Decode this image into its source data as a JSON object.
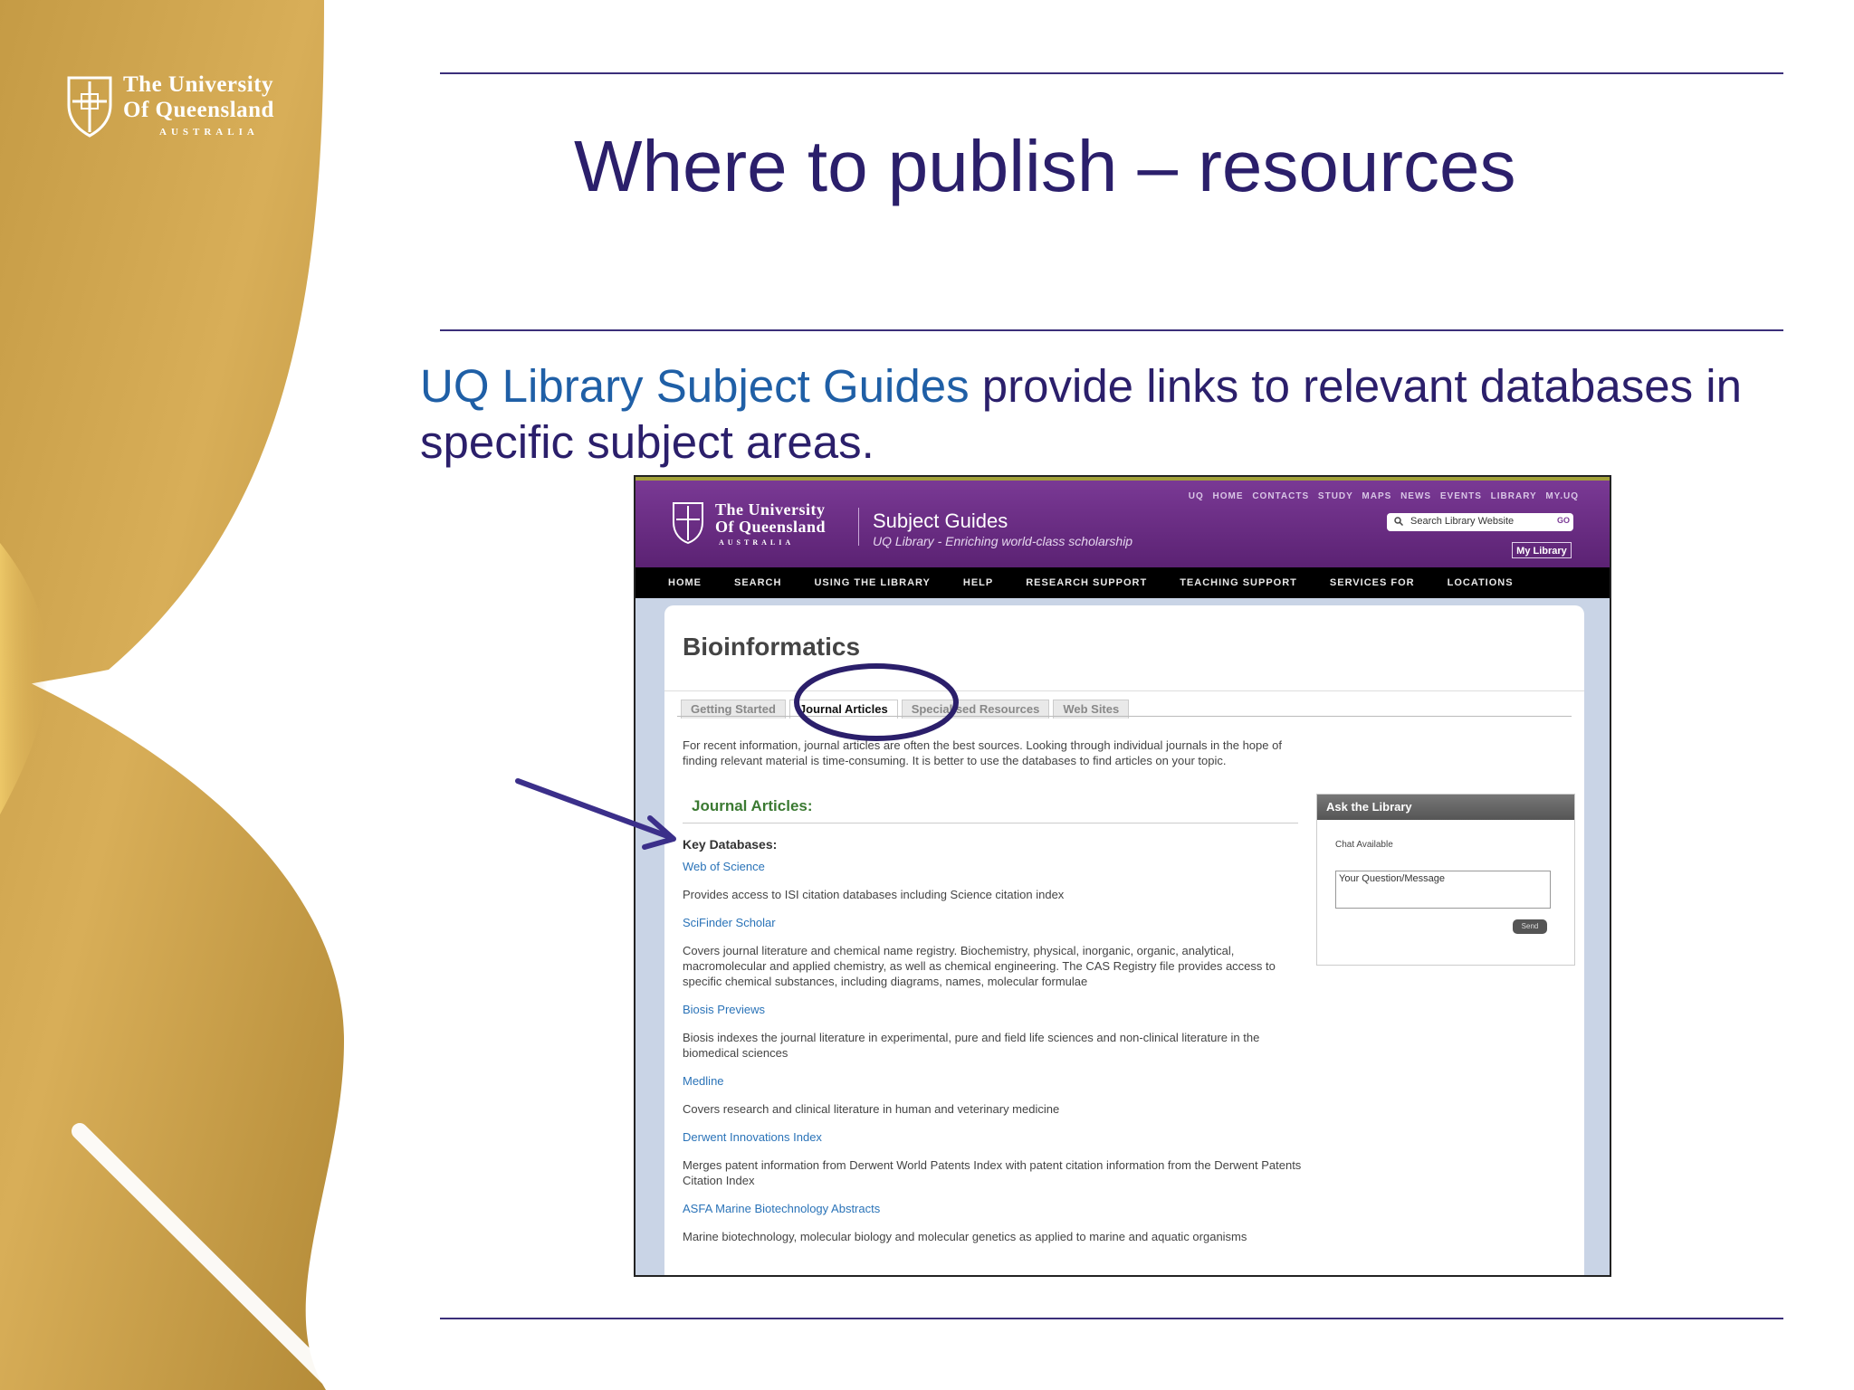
{
  "slide": {
    "logo": {
      "line1": "The University",
      "line2": "Of Queensland",
      "line3": "AUSTRALIA"
    },
    "title": "Where to publish – resources",
    "body_link": "UQ Library Subject Guides",
    "body_rest": " provide links to relevant databases in specific subject areas."
  },
  "colors": {
    "gold": "#cda24a",
    "title_purple": "#2b1f6b",
    "link_blue": "#1f5fa6",
    "uq_purple": "#6b2d86"
  },
  "screenshot": {
    "top_links": "UQ HOME  CONTACTS  STUDY  MAPS  NEWS  EVENTS  LIBRARY  MY.UQ",
    "logo": {
      "line1": "The University",
      "line2": "Of Queensland",
      "line3": "AUSTRALIA"
    },
    "site_title": "Subject Guides",
    "site_subtitle": "UQ Library - Enriching world-class scholarship",
    "search_placeholder": "Search Library Website",
    "search_go": "GO",
    "my_library": "My Library",
    "nav": [
      "HOME",
      "SEARCH",
      "USING THE LIBRARY",
      "HELP",
      "RESEARCH SUPPORT",
      "TEACHING SUPPORT",
      "SERVICES FOR",
      "LOCATIONS"
    ],
    "page_heading": "Bioinformatics",
    "tabs": [
      "Getting Started",
      "Journal Articles",
      "Specialised Resources",
      "Web Sites"
    ],
    "intro": "For recent information, journal articles are often the best sources. Looking through individual journals in the hope of finding relevant material is time-consuming. It is better to use the databases to find articles on your topic.",
    "section_heading": "Journal Articles:",
    "key_databases": "Key Databases:",
    "databases": [
      {
        "name": "Web of Science",
        "desc": "Provides access to ISI citation databases including Science citation index"
      },
      {
        "name": "SciFinder Scholar",
        "desc": "Covers journal literature and chemical name registry. Biochemistry, physical, inorganic, organic, analytical, macromolecular and applied chemistry, as well as chemical engineering. The CAS Registry file provides access to specific chemical substances, including diagrams, names, molecular formulae"
      },
      {
        "name": "Biosis Previews",
        "desc": "Biosis indexes the journal literature in experimental, pure and field life sciences and non-clinical literature in the biomedical sciences"
      },
      {
        "name": "Medline",
        "desc": "Covers research and clinical literature in human and veterinary medicine"
      },
      {
        "name": "Derwent Innovations Index",
        "desc": "Merges patent information from Derwent World Patents Index with patent citation information from the Derwent Patents Citation Index"
      },
      {
        "name": "ASFA Marine Biotechnology Abstracts",
        "desc": "Marine biotechnology, molecular biology and molecular genetics as applied to marine and aquatic organisms"
      }
    ],
    "ask": {
      "title": "Ask the Library",
      "status": "Chat Available",
      "placeholder": "Your Question/Message",
      "send": "Send"
    }
  }
}
